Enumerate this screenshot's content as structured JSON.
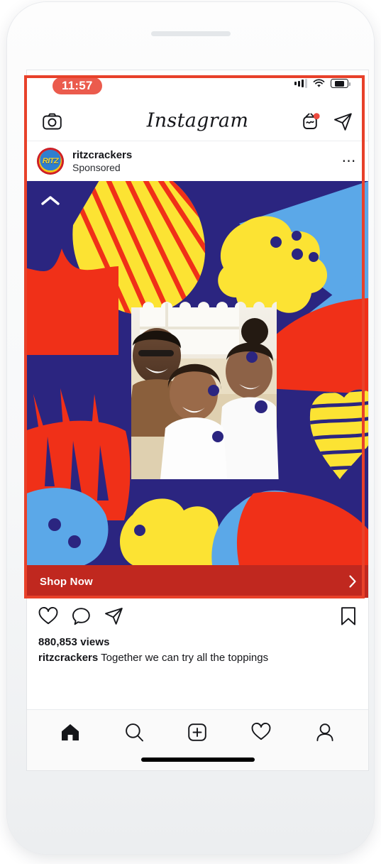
{
  "device": {
    "frame_color": "#f7f8f9",
    "speaker_color": "#e4e7ea"
  },
  "status_bar": {
    "time": "11:57",
    "time_pill_color": "#eb5b4d",
    "signal_icon": "cellular-signal-icon",
    "wifi_icon": "wifi-icon",
    "battery_icon": "battery-icon",
    "battery_level_percent": 66
  },
  "app_bar": {
    "wordmark": "Instagram",
    "camera_icon": "camera-icon",
    "igtv_icon": "igtv-icon",
    "igtv_badge_color": "#ec4a3f",
    "direct_icon": "direct-message-icon"
  },
  "highlight": {
    "color": "#e8412a",
    "border_width": "4px"
  },
  "post": {
    "avatar_icon": "ritz-brand-avatar",
    "avatar_wordmark": "RITZ",
    "account_name": "ritzcrackers",
    "subtitle": "Sponsored",
    "more_options_icon": "more-options-icon",
    "expand_icon": "chevron-up-icon",
    "cta": {
      "label": "Shop Now",
      "chevron_icon": "chevron-right-icon",
      "background_color": "#c0281f"
    },
    "actions": {
      "like_icon": "heart-icon",
      "comment_icon": "comment-bubble-icon",
      "share_icon": "share-paper-plane-icon",
      "save_icon": "bookmark-icon"
    },
    "views": "880,853 views",
    "caption_author": "ritzcrackers",
    "caption_text": "Together we can try all the toppings",
    "creative": {
      "description": "Colorful collage ad: family laughing, cut-paper shapes",
      "palette": {
        "navy": "#2b2580",
        "yellow": "#fce333",
        "red": "#f03018",
        "light_blue": "#5ba8e8",
        "cream": "#f3ead0"
      }
    }
  },
  "tab_bar": {
    "items": [
      {
        "name": "home",
        "icon": "home-icon",
        "active": true
      },
      {
        "name": "search",
        "icon": "search-icon",
        "active": false
      },
      {
        "name": "create",
        "icon": "plus-square-icon",
        "active": false
      },
      {
        "name": "activity",
        "icon": "heart-icon",
        "active": false
      },
      {
        "name": "profile",
        "icon": "person-icon",
        "active": false
      }
    ],
    "home_indicator": "home-indicator-bar"
  }
}
